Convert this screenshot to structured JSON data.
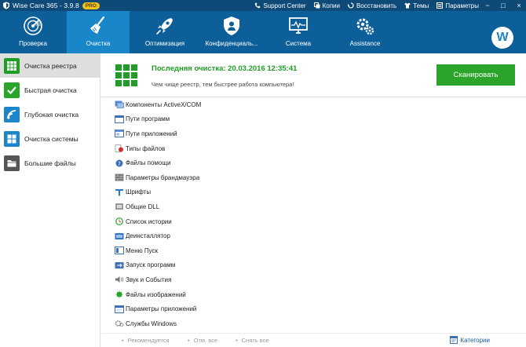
{
  "window": {
    "title": "Wise Care 365 - 3.9.8",
    "badge": "PRO",
    "links": [
      {
        "label": "Support Center",
        "icon": "phone-icon"
      },
      {
        "label": "Копии",
        "icon": "copy-icon"
      },
      {
        "label": "Восстановить",
        "icon": "restore-icon"
      },
      {
        "label": "Темы",
        "icon": "shirt-icon"
      },
      {
        "label": "Параметры",
        "icon": "settings-icon"
      }
    ],
    "controls": [
      "−",
      "□",
      "×"
    ]
  },
  "tabs": [
    {
      "label": "Проверка",
      "icon": "radar-icon"
    },
    {
      "label": "Очистка",
      "icon": "broom-icon",
      "active": true
    },
    {
      "label": "Оптимизация",
      "icon": "rocket-icon"
    },
    {
      "label": "Конфиденциаль...",
      "icon": "shield-icon"
    },
    {
      "label": "Система",
      "icon": "monitor-icon"
    },
    {
      "label": "Assistance",
      "icon": "gears-icon"
    }
  ],
  "avatar": {
    "letter": "W"
  },
  "sidebar": {
    "items": [
      {
        "label": "Очистка реестра",
        "icon": "registry-grid-icon",
        "color": "#1f9e25",
        "active": true
      },
      {
        "label": "Быстрая очистка",
        "icon": "check-icon",
        "color": "#2aa52a"
      },
      {
        "label": "Глубокая очистка",
        "icon": "layers-icon",
        "color": "#1c86c8"
      },
      {
        "label": "Очистка системы",
        "icon": "windows-icon",
        "color": "#1c86c8"
      },
      {
        "label": "Большие файлы",
        "icon": "folder-icon",
        "color": "#555555"
      }
    ]
  },
  "header": {
    "last_clean": "Последняя очистка: 20.03.2016 12:35:41",
    "tagline": "Чем чище реестр, тем быстрее работа компьютера!",
    "scan_label": "Сканировать"
  },
  "list": {
    "items": [
      {
        "label": "Компоненты ActiveX/COM",
        "icon": "activex-icon"
      },
      {
        "label": "Пути программ",
        "icon": "program-path-icon"
      },
      {
        "label": "Пути приложений",
        "icon": "app-path-icon"
      },
      {
        "label": "Типы файлов",
        "icon": "filetype-icon"
      },
      {
        "label": "Файлы помощи",
        "icon": "help-file-icon"
      },
      {
        "label": "Параметры брандмауэра",
        "icon": "firewall-icon"
      },
      {
        "label": "Шрифты",
        "icon": "font-icon"
      },
      {
        "label": "Общие DLL",
        "icon": "dll-icon"
      },
      {
        "label": "Список истории",
        "icon": "history-icon"
      },
      {
        "label": "Деинсталлятор",
        "icon": "uninstaller-icon"
      },
      {
        "label": "Меню Пуск",
        "icon": "start-menu-icon"
      },
      {
        "label": "Запуск программ",
        "icon": "startup-icon"
      },
      {
        "label": "Звук и События",
        "icon": "sound-icon"
      },
      {
        "label": "Файлы изображений",
        "icon": "image-file-icon"
      },
      {
        "label": "Параметры приложений",
        "icon": "app-settings-icon"
      },
      {
        "label": "Службы Windows",
        "icon": "services-icon"
      }
    ]
  },
  "footer": {
    "recommended": "Рекомендуется",
    "select_none": "Отм. все",
    "deselect_all": "Снять все",
    "categories": "Категории"
  },
  "colors": {
    "title_bar": "#0e4a78",
    "tab_bar": "#0d5f99",
    "tab_active": "#1886c9",
    "accent_green": "#1f9e25",
    "scan_button": "#2aa52a"
  }
}
